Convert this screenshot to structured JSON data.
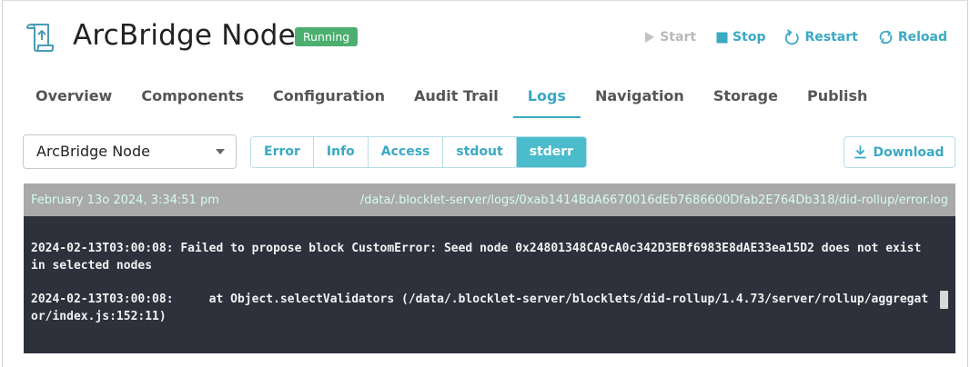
{
  "header": {
    "title": "ArcBridge Node",
    "status": "Running",
    "status_color": "#4caf70",
    "icon": "scroll-upload-icon",
    "actions": [
      {
        "label": "Start",
        "icon": "play-icon",
        "enabled": false
      },
      {
        "label": "Stop",
        "icon": "stop-icon",
        "enabled": true
      },
      {
        "label": "Restart",
        "icon": "restart-icon",
        "enabled": true
      },
      {
        "label": "Reload",
        "icon": "reload-icon",
        "enabled": true
      }
    ]
  },
  "tabs": [
    {
      "label": "Overview",
      "active": false
    },
    {
      "label": "Components",
      "active": false
    },
    {
      "label": "Configuration",
      "active": false
    },
    {
      "label": "Audit Trail",
      "active": false
    },
    {
      "label": "Logs",
      "active": true
    },
    {
      "label": "Navigation",
      "active": false
    },
    {
      "label": "Storage",
      "active": false
    },
    {
      "label": "Publish",
      "active": false
    }
  ],
  "component_select": {
    "value": "ArcBridge Node"
  },
  "log_types": [
    {
      "label": "Error",
      "active": false
    },
    {
      "label": "Info",
      "active": false
    },
    {
      "label": "Access",
      "active": false
    },
    {
      "label": "stdout",
      "active": false
    },
    {
      "label": "stderr",
      "active": true
    }
  ],
  "download_label": "Download",
  "log": {
    "timestamp": "February 13o 2024, 3:34:51 pm",
    "path": "/data/.blocklet-server/logs/0xab1414BdA6670016dEb7686600Dfab2E764Db318/did-rollup/error.log",
    "lines": [
      "2024-02-13T03:00:08: Failed to propose block CustomError: Seed node 0x24801348CA9cA0c342D3EBf6983E8dAE33ea15D2 does not exist in selected nodes",
      "2024-02-13T03:00:08:     at Object.selectValidators (/data/.blocklet-server/blocklets/did-rollup/1.4.73/server/rollup/aggregator/index.js:152:11)"
    ]
  },
  "colors": {
    "accent": "#3aa9c4",
    "active_segment": "#4bbccb",
    "log_background": "#2e313c",
    "log_header": "#a9a9a9"
  }
}
